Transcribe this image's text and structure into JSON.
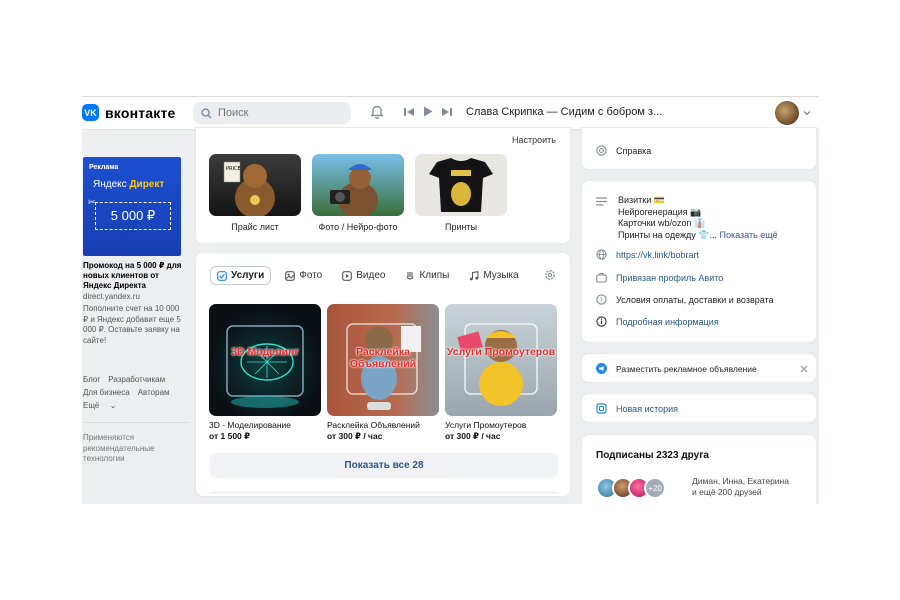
{
  "header": {
    "logo_text": "вконтакте",
    "logo_mark": "VK",
    "search_placeholder": "Поиск",
    "now_playing": "Слава Скрипка — Сидим с бобром з...",
    "icons": [
      "search-icon",
      "bell-icon",
      "prev-icon",
      "play-icon",
      "next-icon",
      "chevron-down-icon"
    ]
  },
  "ad": {
    "tag": "Реклама",
    "brand": "Яндекс",
    "brand_product": "Директ",
    "amount": "5 000 ₽",
    "title": "Промокод на 5 000 ₽ для новых клиентов от Яндекс Директа",
    "domain": "direct.yandex.ru",
    "description": "Пополните счет на 10 000 ₽ и Яндекс добавит еще 5 000 ₽. Оставьте заявку на сайте!"
  },
  "footer": {
    "links": [
      "Блог",
      "Разработчикам",
      "Для бизнеса",
      "Авторам",
      "Ещё"
    ],
    "recommend": "Применяются рекомендательные технологии"
  },
  "albums": {
    "settings_label": "Настроить",
    "items": [
      {
        "caption": "Прайс лист"
      },
      {
        "caption": "Фото / Нейро-фото"
      },
      {
        "caption": "Принты"
      }
    ]
  },
  "tabs": [
    {
      "label": "Услуги",
      "icon": "check-square-icon"
    },
    {
      "label": "Фото",
      "icon": "image-icon"
    },
    {
      "label": "Видео",
      "icon": "video-icon"
    },
    {
      "label": "Клипы",
      "icon": "clip-icon"
    },
    {
      "label": "Музыка",
      "icon": "music-icon"
    }
  ],
  "services": [
    {
      "name": "3D - Моделирование",
      "price": "от 1 500 ₽",
      "overlay": "3D Моделинг"
    },
    {
      "name": "Расклейка Объявлений",
      "price": "от 300 ₽ / час",
      "overlay": "Расклейка Объявлений"
    },
    {
      "name": "Услуги Промоутеров",
      "price": "от 300 ₽ / час",
      "overlay": "Услуги Промоутеров"
    }
  ],
  "show_all": "Показать все 28",
  "right": {
    "help": "Справка",
    "info_lines": [
      "Визитки 💳",
      "Нейрогенерация 📷",
      "Карточки wb/ozon 👔",
      "Принты на одежду 👕..."
    ],
    "show_more": "Показать ещё",
    "url": "https://vk.link/bobrart",
    "avito": "Привязан профиль Авито",
    "terms": "Условия оплаты, доставки и возврата",
    "details": "Подробная информация",
    "place_ad": "Разместить рекламное объявление",
    "new_story": "Новая история",
    "friends_title": "Подписаны 2323 друга",
    "friends_more": "+20",
    "friends_text_1": "Диман, Инна, Екатерина",
    "friends_text_2": "и ещё 200 друзей"
  },
  "colors": {
    "accent": "#0077ff",
    "link": "#2a5885",
    "background": "#edeef0"
  }
}
